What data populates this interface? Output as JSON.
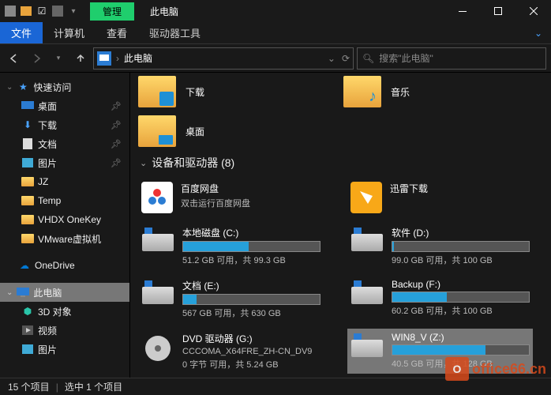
{
  "titlebar": {
    "context_tab": "管理",
    "title": "此电脑"
  },
  "ribbon": {
    "file": "文件",
    "computer": "计算机",
    "view": "查看",
    "drive_tools": "驱动器工具"
  },
  "nav": {
    "address": "此电脑",
    "search_placeholder": "搜索\"此电脑\""
  },
  "sidebar": {
    "quick_access": "快速访问",
    "items_qa": [
      {
        "label": "桌面",
        "pinned": true,
        "icon": "desktop"
      },
      {
        "label": "下载",
        "pinned": true,
        "icon": "download"
      },
      {
        "label": "文档",
        "pinned": true,
        "icon": "doc"
      },
      {
        "label": "图片",
        "pinned": true,
        "icon": "pic"
      },
      {
        "label": "JZ",
        "pinned": false,
        "icon": "folder"
      },
      {
        "label": "Temp",
        "pinned": false,
        "icon": "folder"
      },
      {
        "label": "VHDX OneKey",
        "pinned": false,
        "icon": "folder"
      },
      {
        "label": "VMware虚拟机",
        "pinned": false,
        "icon": "folder"
      }
    ],
    "onedrive": "OneDrive",
    "this_pc": "此电脑",
    "items_pc": [
      {
        "label": "3D 对象"
      },
      {
        "label": "视频"
      },
      {
        "label": "图片"
      }
    ]
  },
  "content": {
    "folders": [
      {
        "label": "下载",
        "type": "dl"
      },
      {
        "label": "音乐",
        "type": "music"
      },
      {
        "label": "桌面",
        "type": "desk"
      }
    ],
    "section_title": "设备和驱动器 (8)",
    "apps": [
      {
        "name": "百度网盘",
        "sub": "双击运行百度网盘",
        "kind": "baidu"
      },
      {
        "name": "迅雷下载",
        "sub": "",
        "kind": "xl"
      }
    ],
    "drives": [
      {
        "name": "本地磁盘 (C:)",
        "free": "51.2 GB 可用，共 99.3 GB",
        "pct": 48
      },
      {
        "name": "软件 (D:)",
        "free": "99.0 GB 可用，共 100 GB",
        "pct": 1
      },
      {
        "name": "文档 (E:)",
        "free": "567 GB 可用，共 630 GB",
        "pct": 10
      },
      {
        "name": "Backup (F:)",
        "free": "60.2 GB 可用，共 100 GB",
        "pct": 40
      },
      {
        "name": "DVD 驱动器 (G:)",
        "sub2": "CCCOMA_X64FRE_ZH-CN_DV9",
        "free": "0 字节 可用，共 5.24 GB",
        "pct": 100,
        "dvd": true
      },
      {
        "name": "WIN8_V (Z:)",
        "free": "40.5 GB 可用，共 128 GB",
        "pct": 68,
        "selected": true
      }
    ]
  },
  "status": {
    "items": "15 个项目",
    "selected": "选中 1 个项目"
  },
  "watermark": "office66.cn"
}
